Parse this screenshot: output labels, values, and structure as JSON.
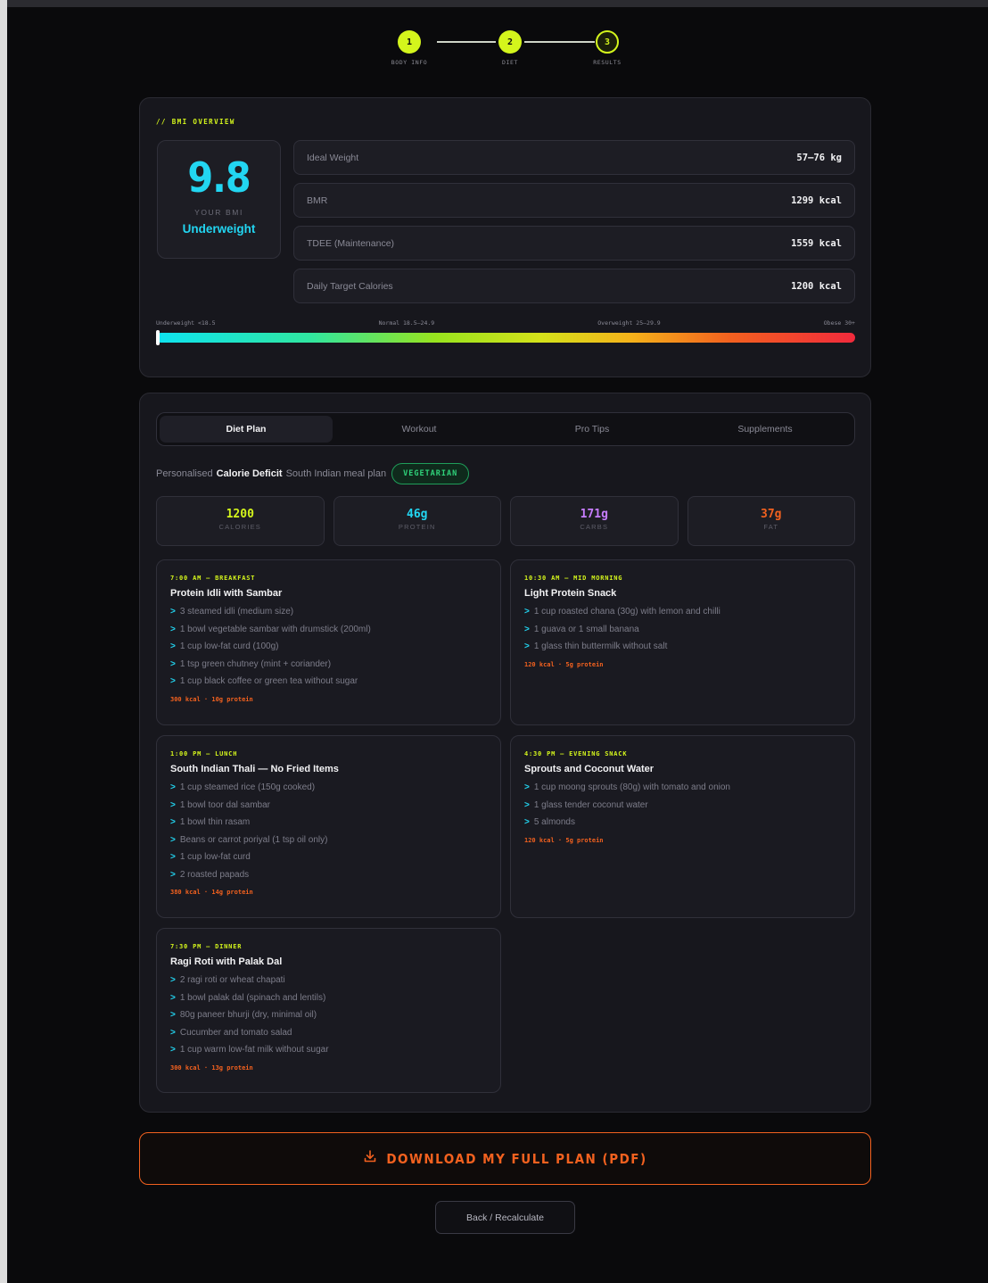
{
  "stepper": {
    "steps": [
      {
        "number": "1",
        "label": "BODY INFO"
      },
      {
        "number": "2",
        "label": "DIET"
      },
      {
        "number": "3",
        "label": "RESULTS"
      }
    ]
  },
  "bmi": {
    "section_title": "// BMI OVERVIEW",
    "value": "9.8",
    "sublabel": "YOUR BMI",
    "category": "Underweight",
    "metrics": [
      {
        "label": "Ideal Weight",
        "value": "57–76 kg"
      },
      {
        "label": "BMR",
        "value": "1299 kcal"
      },
      {
        "label": "TDEE (Maintenance)",
        "value": "1559 kcal"
      },
      {
        "label": "Daily Target Calories",
        "value": "1200 kcal"
      }
    ],
    "scale": {
      "labels": [
        "Underweight <18.5",
        "Normal 18.5–24.9",
        "Overweight 25–29.9",
        "Obese 30+"
      ],
      "marker_fraction": 0.0
    }
  },
  "tabs": [
    "Diet Plan",
    "Workout",
    "Pro Tips",
    "Supplements"
  ],
  "active_tab": "Diet Plan",
  "plan": {
    "desc_prefix": "Personalised",
    "desc_bold": "Calorie Deficit",
    "desc_suffix": "South Indian meal plan",
    "badge": "VEGETARIAN"
  },
  "macros": [
    {
      "value": "1200",
      "label": "CALORIES",
      "color": "#d4f51c"
    },
    {
      "value": "46g",
      "label": "PROTEIN",
      "color": "#22d6f2"
    },
    {
      "value": "171g",
      "label": "CARBS",
      "color": "#c77dff"
    },
    {
      "value": "37g",
      "label": "FAT",
      "color": "#f2611f"
    }
  ],
  "meals": [
    {
      "time": "7:00 AM — BREAKFAST",
      "name": "Protein Idli with Sambar",
      "items": [
        "3 steamed idli (medium size)",
        "1 bowl vegetable sambar with drumstick (200ml)",
        "1 cup low-fat curd (100g)",
        "1 tsp green chutney (mint + coriander)",
        "1 cup black coffee or green tea without sugar"
      ],
      "footer": "300 kcal · 10g protein"
    },
    {
      "time": "10:30 AM — MID MORNING",
      "name": "Light Protein Snack",
      "items": [
        "1 cup roasted chana (30g) with lemon and chilli",
        "1 guava or 1 small banana",
        "1 glass thin buttermilk without salt"
      ],
      "footer": "120 kcal · 5g protein"
    },
    {
      "time": "1:00 PM — LUNCH",
      "name": "South Indian Thali — No Fried Items",
      "items": [
        "1 cup steamed rice (150g cooked)",
        "1 bowl toor dal sambar",
        "1 bowl thin rasam",
        "Beans or carrot poriyal (1 tsp oil only)",
        "1 cup low-fat curd",
        "2 roasted papads"
      ],
      "footer": "380 kcal · 14g protein"
    },
    {
      "time": "4:30 PM — EVENING SNACK",
      "name": "Sprouts and Coconut Water",
      "items": [
        "1 cup moong sprouts (80g) with tomato and onion",
        "1 glass tender coconut water",
        "5 almonds"
      ],
      "footer": "120 kcal · 5g protein"
    },
    {
      "time": "7:30 PM — DINNER",
      "name": "Ragi Roti with Palak Dal",
      "items": [
        "2 ragi roti or wheat chapati",
        "1 bowl palak dal (spinach and lentils)",
        "80g paneer bhurji (dry, minimal oil)",
        "Cucumber and tomato salad",
        "1 cup warm low-fat milk without sugar"
      ],
      "footer": "300 kcal · 13g protein"
    }
  ],
  "actions": {
    "download_label": "DOWNLOAD MY FULL PLAN (PDF)",
    "back_label": "Back / Recalculate"
  },
  "icons": {
    "download": "download-icon",
    "item_bullet": "chevron-right-icon"
  }
}
